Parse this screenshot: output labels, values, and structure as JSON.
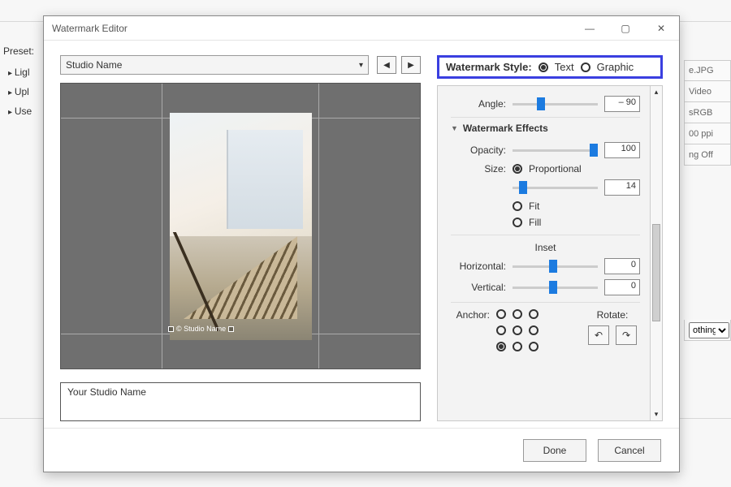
{
  "background": {
    "preset_label": "Preset:",
    "tree": [
      "Ligl",
      "Upl",
      "Use"
    ],
    "right_strip_top": [
      "e.JPG",
      "Video",
      "sRGB",
      "00 ppi",
      "ng Off"
    ],
    "right_strip_bottom_option": "othing"
  },
  "dialog": {
    "title": "Watermark Editor",
    "winbtns": {
      "min": "—",
      "max": "▢",
      "close": "✕"
    }
  },
  "left": {
    "preset_selected": "Studio Name",
    "nav_prev": "◀",
    "nav_next": "▶",
    "wm_sample_label": "©  Studio Name",
    "textarea_value": "Your Studio Name"
  },
  "right": {
    "style_label": "Watermark Style:",
    "style_text": "Text",
    "style_graphic": "Graphic",
    "angle_label": "Angle:",
    "angle_value": "– 90",
    "effects_header": "Watermark Effects",
    "opacity_label": "Opacity:",
    "opacity_value": "100",
    "size_label": "Size:",
    "size_proportional": "Proportional",
    "size_value": "14",
    "size_fit": "Fit",
    "size_fill": "Fill",
    "inset_label": "Inset",
    "horiz_label": "Horizontal:",
    "horiz_value": "0",
    "vert_label": "Vertical:",
    "vert_value": "0",
    "anchor_label": "Anchor:",
    "anchor_selected_index": 6,
    "rotate_label": "Rotate:",
    "rotate_left": "↶",
    "rotate_right": "↷"
  },
  "footer": {
    "done": "Done",
    "cancel": "Cancel"
  },
  "slider_positions": {
    "angle": 33,
    "opacity": 95,
    "size": 12,
    "horiz": 48,
    "vert": 48
  }
}
